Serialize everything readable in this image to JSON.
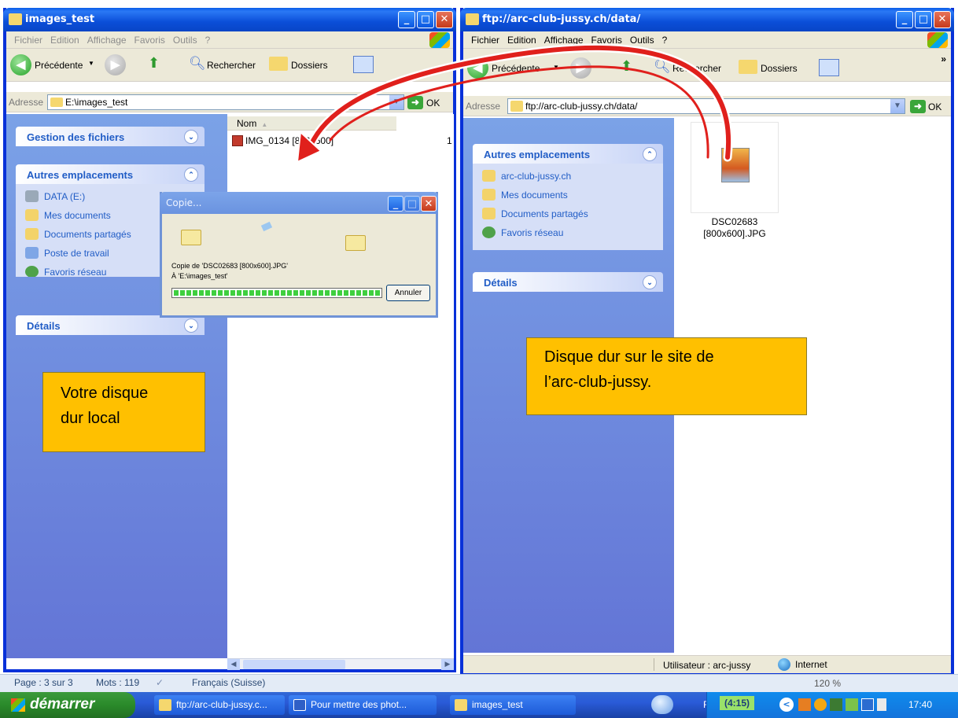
{
  "left_window": {
    "title": "images_test",
    "menu": [
      "Fichier",
      "Edition",
      "Affichage",
      "Favoris",
      "Outils",
      "?"
    ],
    "toolbar": {
      "back": "Précédente",
      "search": "Rechercher",
      "folders": "Dossiers"
    },
    "address_label": "Adresse",
    "address_value": "E:\\images_test",
    "ok_label": "OK",
    "panels": {
      "file_tasks": "Gestion des fichiers",
      "other_places": {
        "title": "Autres emplacements",
        "items": [
          "DATA (E:)",
          "Mes documents",
          "Documents partagés",
          "Poste de travail",
          "Favoris réseau"
        ]
      },
      "details": "Détails"
    },
    "column_header": "Nom",
    "file_name": "IMG_0134 [800x600]",
    "size_fragment": "1"
  },
  "copy_dialog": {
    "title": "Copie...",
    "line1": "Copie de 'DSC02683 [800x600].JPG'",
    "line2": "À 'E:\\images_test'",
    "cancel": "Annuler",
    "progress": 1.0
  },
  "right_window": {
    "title": "ftp://arc-club-jussy.ch/data/",
    "menu": [
      "Fichier",
      "Edition",
      "Affichage",
      "Favoris",
      "Outils",
      "?"
    ],
    "toolbar": {
      "back": "Précédente",
      "search": "Rechercher",
      "folders": "Dossiers"
    },
    "address_label": "Adresse",
    "address_value": "ftp://arc-club-jussy.ch/data/",
    "ok_label": "OK",
    "panels": {
      "other_places": {
        "title": "Autres emplacements",
        "items": [
          "arc-club-jussy.ch",
          "Mes documents",
          "Documents partagés",
          "Favoris réseau"
        ]
      },
      "details": "Détails"
    },
    "file_name_line1": "DSC02683",
    "file_name_line2": "[800x600].JPG",
    "status_user": "Utilisateur : arc-jussy",
    "status_zone": "Internet"
  },
  "annotations": {
    "local_line1": "Votre disque",
    "local_line2": "dur local",
    "remote_line1": "Disque dur sur le site de",
    "remote_line2": "l’arc-club-jussy."
  },
  "word_statusbar": {
    "page": "Page : 3 sur 3",
    "words": "Mots : 119",
    "language": "Français (Suisse)",
    "zoom": "120 %"
  },
  "taskbar": {
    "start": "démarrer",
    "tasks": [
      "ftp://arc-club-jussy.c...",
      "Pour mettre des phot...",
      "images_test"
    ],
    "lang": "FR",
    "counter": "(4:15)",
    "clock": "17:40"
  },
  "colors": {
    "xp_blue": "#0831d9",
    "side_pane": "#6f8de0",
    "annotation": "#ffc000",
    "arrow": "#e0201c"
  }
}
